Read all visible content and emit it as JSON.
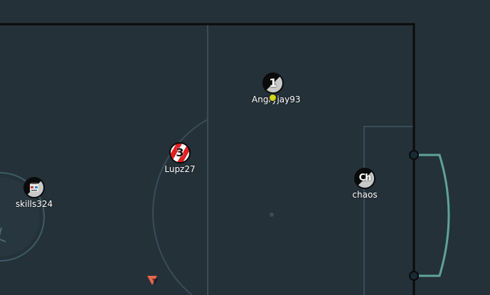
{
  "colors": {
    "field": "#243139",
    "field_lines": "#3a4c58",
    "goal_line": "#0b0b0b",
    "goal_net": "#5fa39b",
    "ball_marker": "#d6d61a",
    "offscreen_marker": "#e8654e"
  },
  "players": [
    {
      "name": "Angryjay93",
      "avatar": "1",
      "style": "split-white-black",
      "has_ball": true
    },
    {
      "name": "Lupz27",
      "avatar": "3",
      "style": "red-white-stripes",
      "has_ball": false
    },
    {
      "name": "chaos",
      "avatar": "Ch",
      "style": "split-white-black",
      "has_ball": false
    },
    {
      "name": "skills324",
      "avatar": "",
      "style": "face-avatar",
      "has_ball": false
    }
  ],
  "offscreen_indicator": {
    "icon": "triangle-down-icon"
  }
}
